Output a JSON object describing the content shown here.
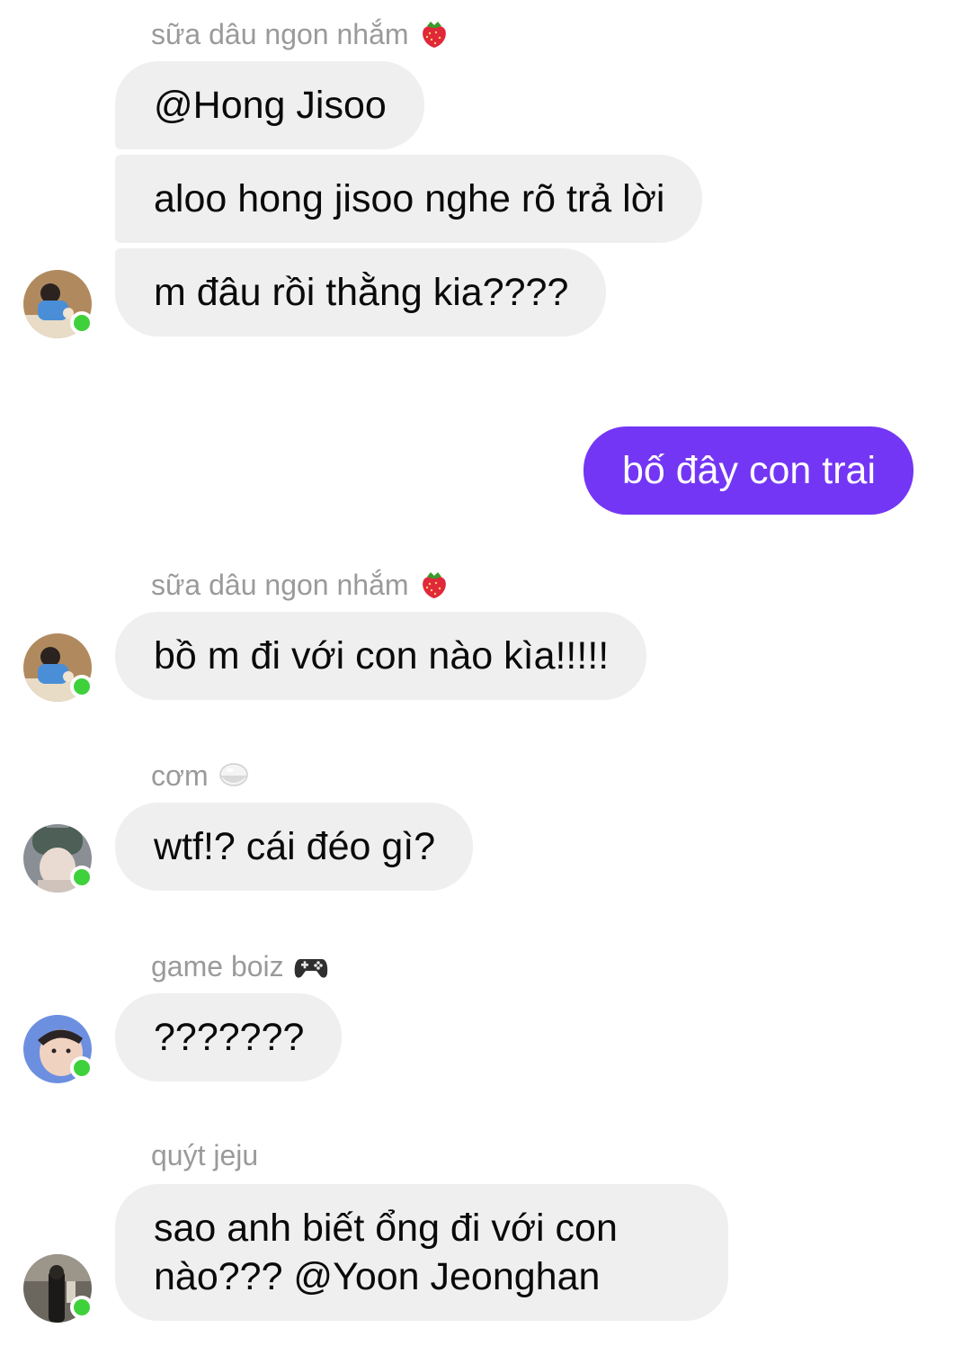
{
  "messages": [
    {
      "sender": "sữa dâu ngon nhắm",
      "sender_emoji": "strawberry-emoji",
      "lines": [
        "@Hong Jisoo",
        "aloo hong jisoo nghe rõ trả lời",
        "m đâu rồi thằng kia????"
      ]
    },
    {
      "mine": true,
      "text": "bố đây con trai",
      "color": "#7436f5"
    },
    {
      "sender": "sữa dâu ngon nhắm",
      "sender_emoji": "strawberry-emoji",
      "lines": [
        "bồ m đi với con nào kìa!!!!!"
      ]
    },
    {
      "sender": "cơm",
      "sender_emoji": "rice-bowl-emoji",
      "lines": [
        "wtf!? cái đéo gì?"
      ]
    },
    {
      "sender": "game boiz",
      "sender_emoji": "game-controller-emoji",
      "lines": [
        "???????"
      ]
    },
    {
      "sender": "quýt jeju",
      "lines": [
        "sao anh biết ổng đi với con nào??? @Yoon Jeonghan"
      ]
    }
  ]
}
